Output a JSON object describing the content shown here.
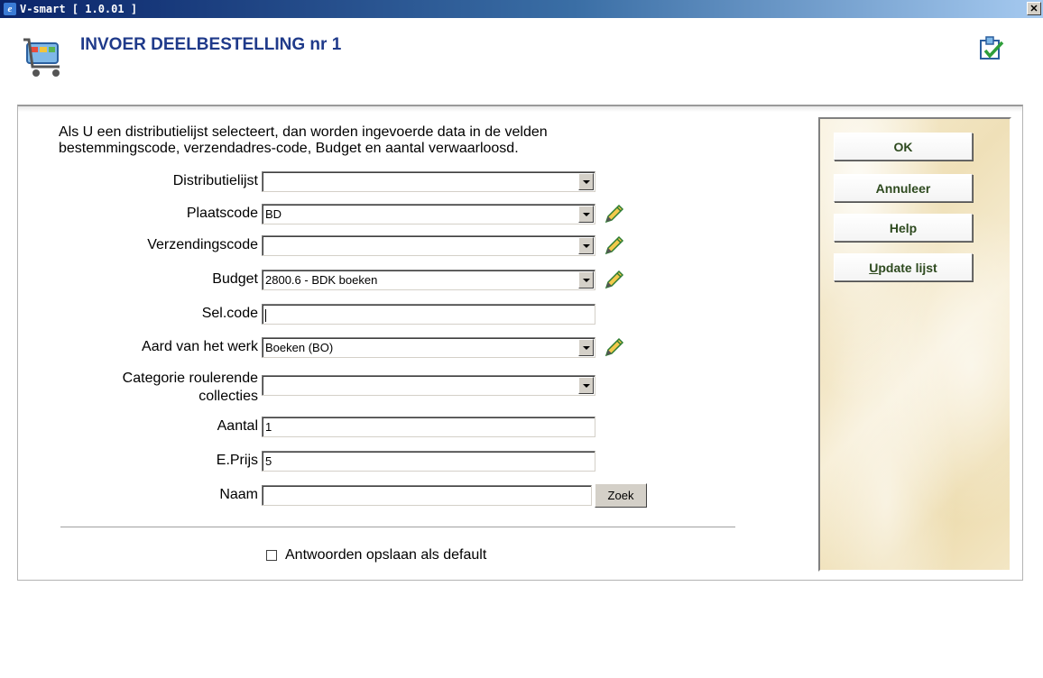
{
  "window": {
    "title": "V-smart [ 1.0.01 ]",
    "close_label": "✕"
  },
  "page": {
    "title": "INVOER DEELBESTELLING nr 1"
  },
  "intro": {
    "line1": "Als U een distributielijst selecteert, dan worden ingevoerde data in de velden",
    "line2": "bestemmingscode, verzendadres-code, Budget en aantal verwaarloosd."
  },
  "form": {
    "distributielijst": {
      "label": "Distributielijst",
      "value": ""
    },
    "plaatscode": {
      "label": "Plaatscode",
      "value": "BD"
    },
    "verzendingscode": {
      "label": "Verzendingscode",
      "value": ""
    },
    "budget": {
      "label": "Budget",
      "value": "2800.6 - BDK boeken"
    },
    "selcode": {
      "label": "Sel.code",
      "value": ""
    },
    "aard": {
      "label": "Aard van het werk",
      "value": "Boeken (BO)"
    },
    "categorie": {
      "label_line1": "Categorie roulerende",
      "label_line2": "collecties",
      "value": ""
    },
    "aantal": {
      "label": "Aantal",
      "value": "1"
    },
    "eprijs": {
      "label": "E.Prijs",
      "value": "5"
    },
    "naam": {
      "label": "Naam",
      "value": ""
    },
    "zoek_label": "Zoek"
  },
  "checkbox": {
    "label": "Antwoorden opslaan als default",
    "checked": false
  },
  "side_buttons": {
    "ok": "OK",
    "annuleer": "Annuleer",
    "help": "Help",
    "update_u": "U",
    "update_rest": "pdate lijst"
  },
  "icons": {
    "window_icon": "ie-icon",
    "header_icon": "shopping-cart-icon",
    "top_right_icon": "checklist-icon",
    "edit_icon": "pencil-icon"
  }
}
